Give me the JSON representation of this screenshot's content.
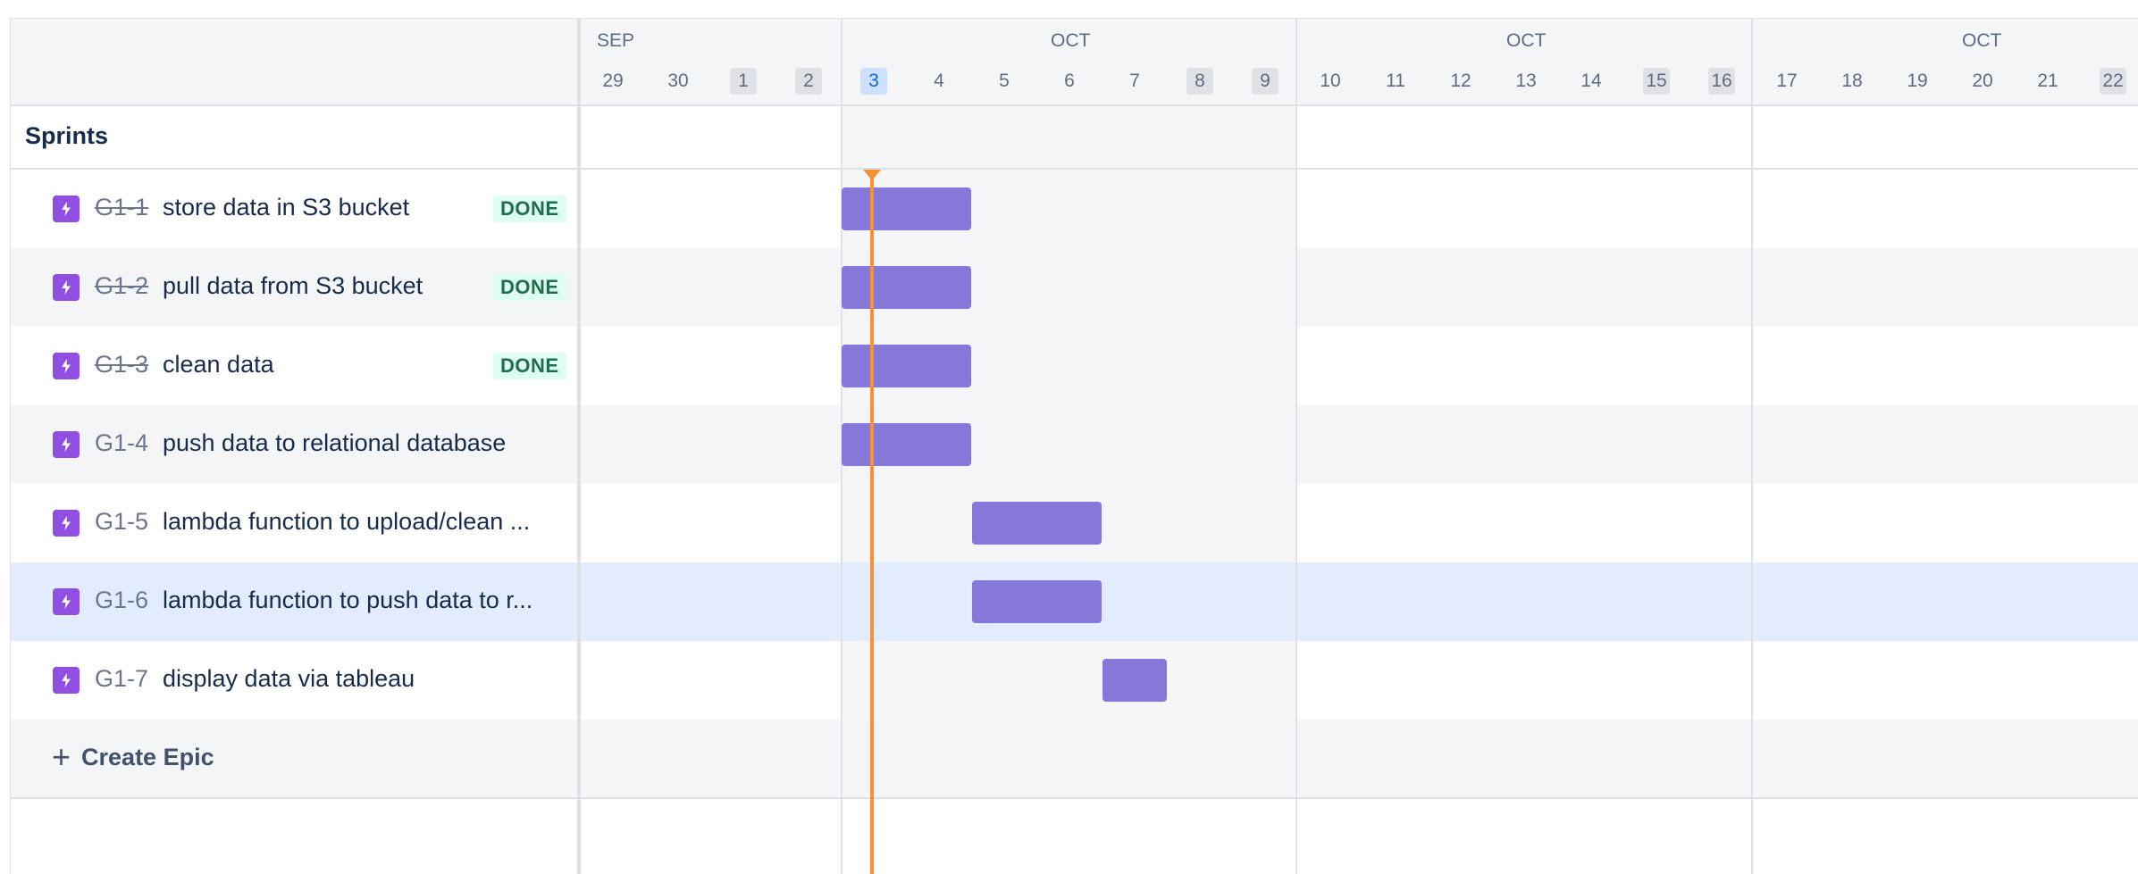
{
  "timeline": {
    "months": [
      {
        "label": "SEP"
      },
      {
        "label": "OCT"
      },
      {
        "label": "OCT"
      },
      {
        "label": "OCT"
      }
    ],
    "days": [
      "29",
      "30",
      "1",
      "2",
      "3",
      "4",
      "5",
      "6",
      "7",
      "8",
      "9",
      "10",
      "11",
      "12",
      "13",
      "14",
      "15",
      "16",
      "17",
      "18",
      "19",
      "20",
      "21",
      "22"
    ],
    "weekend_days": [
      "1",
      "2",
      "8",
      "9",
      "15",
      "16",
      "22"
    ],
    "today": "3"
  },
  "sidebar": {
    "sprints_title": "Sprints",
    "create_epic_label": "Create Epic"
  },
  "issues": [
    {
      "key": "G1-1",
      "summary": "store data in S3 bucket",
      "status": "DONE",
      "done": true
    },
    {
      "key": "G1-2",
      "summary": "pull data from S3 bucket",
      "status": "DONE",
      "done": true
    },
    {
      "key": "G1-3",
      "summary": "clean data",
      "status": "DONE",
      "done": true
    },
    {
      "key": "G1-4",
      "summary": "push data to relational database",
      "status": "",
      "done": false
    },
    {
      "key": "G1-5",
      "summary": "lambda function to upload/clean ...",
      "status": "",
      "done": false
    },
    {
      "key": "G1-6",
      "summary": "lambda function to push data to r...",
      "status": "",
      "done": false
    },
    {
      "key": "G1-7",
      "summary": "display data via tableau",
      "status": "",
      "done": false
    }
  ],
  "colors": {
    "bar": "#8777d9",
    "issue_icon": "#904ee2",
    "today_line": "#f79233",
    "done_badge_text": "#216e4e",
    "done_badge_bg": "#dcfff1",
    "selected_row": "#e2ecfc"
  },
  "icons": {
    "issue": "lightning-bolt-icon",
    "create": "plus-icon"
  }
}
